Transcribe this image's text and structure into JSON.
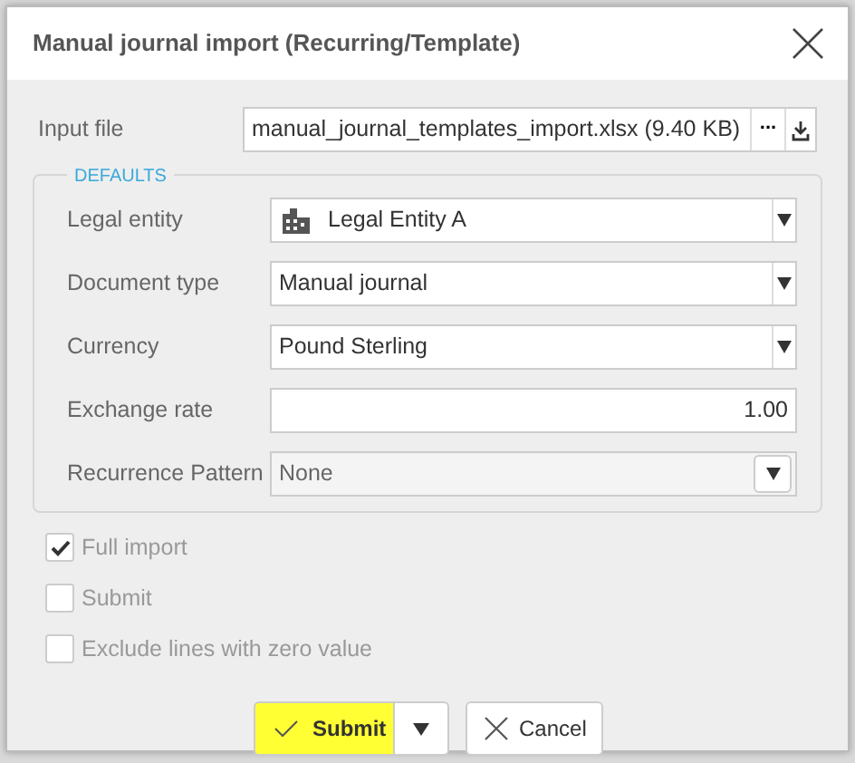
{
  "dialog": {
    "title": "Manual journal import (Recurring/Template)"
  },
  "input_file": {
    "label": "Input file",
    "value": "manual_journal_templates_import.xlsx (9.40 KB)",
    "browse_button": "..."
  },
  "defaults": {
    "legend": "DEFAULTS",
    "fields": [
      {
        "label": "Legal entity",
        "kind": "entity-select",
        "value": "Legal Entity A",
        "disabled": false
      },
      {
        "label": "Document type",
        "kind": "select",
        "value": "Manual journal",
        "disabled": false
      },
      {
        "label": "Currency",
        "kind": "select",
        "value": "Pound Sterling",
        "disabled": false
      },
      {
        "label": "Exchange rate",
        "kind": "number",
        "value": "1.00",
        "disabled": false
      },
      {
        "label": "Recurrence Pattern",
        "kind": "select",
        "value": "None",
        "disabled": true
      }
    ]
  },
  "options": [
    {
      "label": "Full import",
      "checked": true
    },
    {
      "label": "Submit",
      "checked": false
    },
    {
      "label": "Exclude lines with zero value",
      "checked": false
    }
  ],
  "buttons": {
    "submit": "Submit",
    "cancel": "Cancel"
  }
}
